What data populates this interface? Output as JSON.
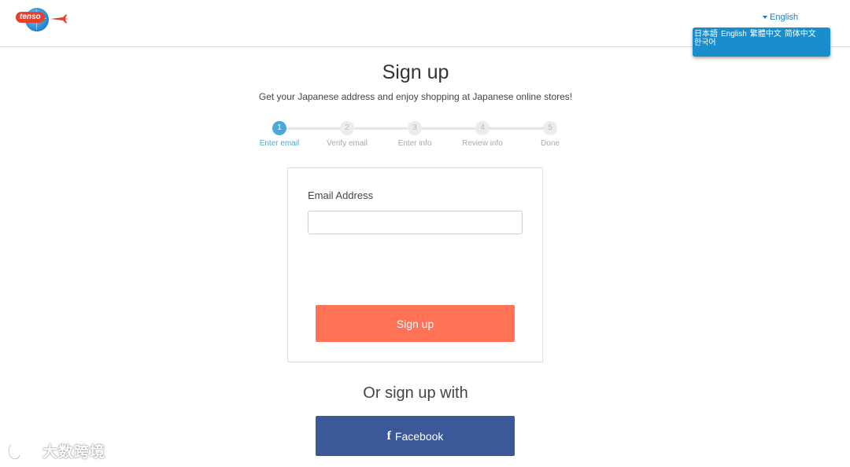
{
  "header": {
    "logo_text": "tenso",
    "language_toggle": {
      "label": "English"
    },
    "language_menu": [
      "日本語",
      "English",
      "繁體中文",
      "简体中文",
      "한국어"
    ]
  },
  "page": {
    "title": "Sign up",
    "subtitle": "Get your Japanese address and enjoy shopping at Japanese online stores!"
  },
  "stepper": {
    "active_step": 1,
    "steps": [
      {
        "number": "1",
        "label": "Enter email"
      },
      {
        "number": "2",
        "label": "Verify email"
      },
      {
        "number": "3",
        "label": "Enter info"
      },
      {
        "number": "4",
        "label": "Review info"
      },
      {
        "number": "5",
        "label": "Done"
      }
    ]
  },
  "form": {
    "email_label": "Email Address",
    "email_value": "",
    "email_placeholder": "",
    "submit_label": "Sign up"
  },
  "alternative": {
    "title": "Or sign up with",
    "facebook_icon": "f",
    "facebook_label": "Facebook"
  },
  "watermark": {
    "text": "大数跨境"
  },
  "colors": {
    "accent_blue": "#4aa9d8",
    "menu_blue": "#1a8dcd",
    "signup_orange": "#ff7256",
    "facebook_blue": "#3b5998"
  }
}
